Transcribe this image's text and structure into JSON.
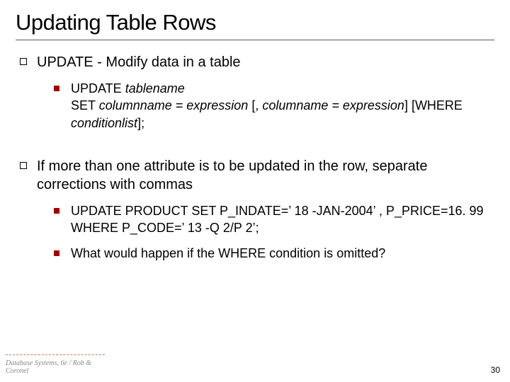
{
  "title": "Updating Table Rows",
  "bullets": {
    "b1": "UPDATE - Modify data in a table",
    "b1_1_pre": "UPDATE ",
    "b1_1_tn": "tablename",
    "b1_1_br": "SET ",
    "b1_1_col": "columnname = expression ",
    "b1_1_mid": "[, ",
    "b1_1_col2": "columname = expression",
    "b1_1_mid2": "] [WHERE ",
    "b1_1_cond": "conditionlist",
    "b1_1_end": "];",
    "b2": "If more than one attribute is to be updated in the row, separate corrections with commas",
    "b2_1": "UPDATE PRODUCT SET P_INDATE=’ 18 -JAN-2004’ , P_PRICE=16. 99 WHERE P_CODE=’ 13 -Q 2/P 2’;",
    "b2_2": "What would happen if the WHERE condition is omitted?"
  },
  "footer": {
    "left": "Database Systems, 6e / Rob & Coronel",
    "page": "30"
  }
}
